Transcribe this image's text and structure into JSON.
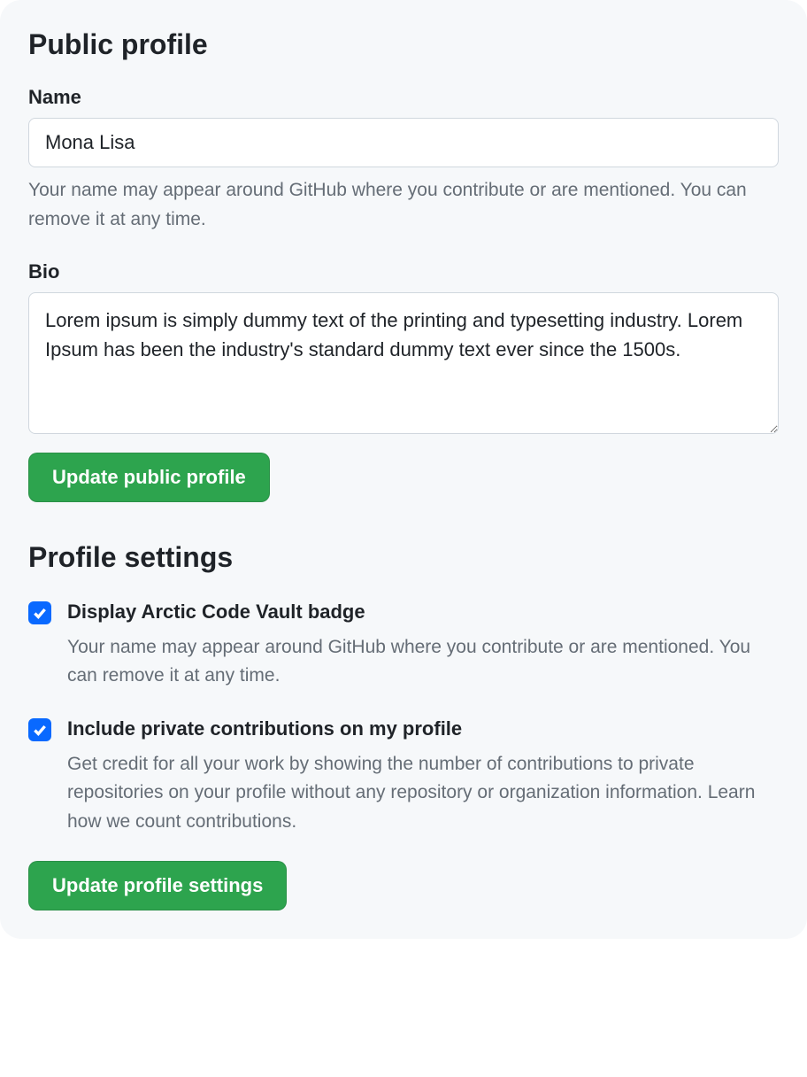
{
  "publicProfile": {
    "title": "Public profile",
    "name": {
      "label": "Name",
      "value": "Mona Lisa",
      "help": "Your name may appear around GitHub where you contribute or are mentioned. You can remove it at any time."
    },
    "bio": {
      "label": "Bio",
      "value": "Lorem ipsum is simply dummy text of the printing and typesetting industry. Lorem Ipsum has been the industry's standard dummy text ever since the 1500s."
    },
    "updateButton": "Update public profile"
  },
  "profileSettings": {
    "title": "Profile settings",
    "checkboxes": [
      {
        "checked": true,
        "label": "Display Arctic Code Vault badge",
        "help": "Your name may appear around GitHub where you contribute or are mentioned. You can remove it at any time."
      },
      {
        "checked": true,
        "label": "Include private contributions on my profile",
        "help": "Get credit for all your work by showing the number of contributions to private repositories on your profile without any repository or organization information. Learn how we count contributions."
      }
    ],
    "updateButton": "Update profile settings"
  }
}
